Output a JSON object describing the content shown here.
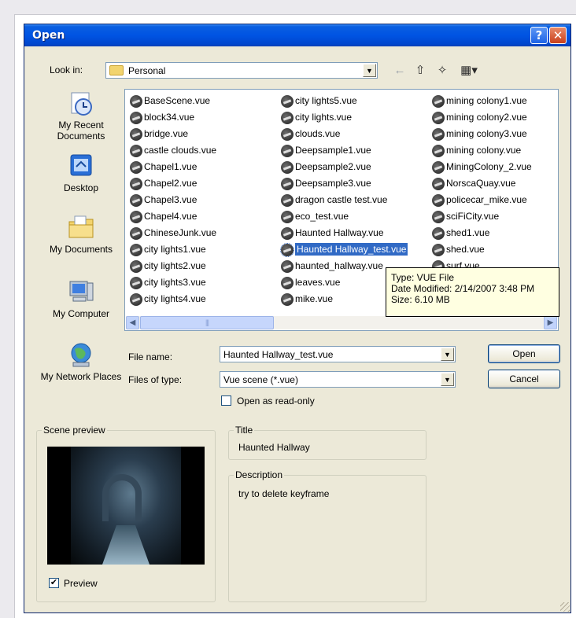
{
  "window": {
    "title": "Open",
    "help_glyph": "?",
    "close_glyph": "✕"
  },
  "toolbar": {
    "look_in_label": "Look in:",
    "look_in_value": "Personal",
    "back_icon": "back-arrow-icon",
    "up_icon": "up-folder-icon",
    "new_folder_icon": "new-folder-icon",
    "views_icon": "views-menu-icon"
  },
  "places": [
    {
      "label": "My Recent Documents",
      "icon": "recent-documents-icon"
    },
    {
      "label": "Desktop",
      "icon": "desktop-icon"
    },
    {
      "label": "My Documents",
      "icon": "my-documents-icon"
    },
    {
      "label": "My Computer",
      "icon": "my-computer-icon"
    },
    {
      "label": "My Network Places",
      "icon": "network-places-icon"
    }
  ],
  "files": {
    "col1": [
      "BaseScene.vue",
      "block34.vue",
      "bridge.vue",
      "castle clouds.vue",
      "Chapel1.vue",
      "Chapel2.vue",
      "Chapel3.vue",
      "Chapel4.vue",
      "ChineseJunk.vue",
      "city lights1.vue",
      "city lights2.vue",
      "city lights3.vue",
      "city lights4.vue"
    ],
    "col2": [
      "city lights5.vue",
      "city lights.vue",
      "clouds.vue",
      "Deepsample1.vue",
      "Deepsample2.vue",
      "Deepsample3.vue",
      "dragon castle test.vue",
      "eco_test.vue",
      "Haunted Hallway.vue",
      "Haunted Hallway_test.vue",
      "haunted_hallway.vue",
      "leaves.vue",
      "mike.vue"
    ],
    "col3": [
      "mining colony1.vue",
      "mining colony2.vue",
      "mining colony3.vue",
      "mining colony.vue",
      "MiningColony_2.vue",
      "NorscaQuay.vue",
      "policecar_mike.vue",
      "sciFiCity.vue",
      "shed1.vue",
      "shed.vue",
      "surf.vue"
    ],
    "selected": "Haunted Hallway_test.vue"
  },
  "tooltip": {
    "type": "Type: VUE File",
    "modified": "Date Modified: 2/14/2007 3:48 PM",
    "size": "Size: 6.10 MB"
  },
  "scrollbar": {
    "left_arrow": "◀",
    "right_arrow": "▶",
    "grip": "|||"
  },
  "form": {
    "file_name_label": "File name:",
    "file_name_value": "Haunted Hallway_test.vue",
    "file_type_label": "Files of type:",
    "file_type_value": "Vue scene (*.vue)",
    "readonly_label": "Open as read-only",
    "readonly_checked": false,
    "open_button": "Open",
    "cancel_button": "Cancel"
  },
  "preview": {
    "group_title": "Scene preview",
    "checkbox_label": "Preview",
    "checkbox_checked": true,
    "check_glyph": "✔"
  },
  "info": {
    "title_label": "Title",
    "title_value": "Haunted Hallway",
    "description_label": "Description",
    "description_value": "try to delete keyframe"
  }
}
